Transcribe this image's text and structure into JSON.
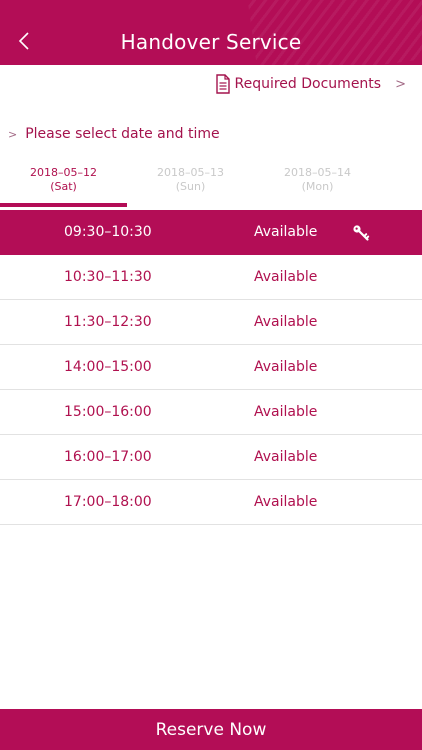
{
  "header": {
    "title": "Handover Service",
    "back_icon": "chevron-left-icon"
  },
  "required_docs": {
    "label": "Required Documents",
    "icon": "document-icon",
    "chevron": ">"
  },
  "prompt": {
    "arrow": ">",
    "text": "Please select date and time"
  },
  "tabs": [
    {
      "date": "2018–05–12",
      "day": "(Sat)",
      "active": true
    },
    {
      "date": "2018–05–13",
      "day": "(Sun)",
      "active": false
    },
    {
      "date": "2018–05–14",
      "day": "(Mon)",
      "active": false
    }
  ],
  "slots": [
    {
      "time": "09:30–10:30",
      "status": "Available",
      "selected": true
    },
    {
      "time": "10:30–11:30",
      "status": "Available",
      "selected": false
    },
    {
      "time": "11:30–12:30",
      "status": "Available",
      "selected": false
    },
    {
      "time": "14:00–15:00",
      "status": "Available",
      "selected": false
    },
    {
      "time": "15:00–16:00",
      "status": "Available",
      "selected": false
    },
    {
      "time": "16:00–17:00",
      "status": "Available",
      "selected": false
    },
    {
      "time": "17:00–18:00",
      "status": "Available",
      "selected": false
    }
  ],
  "reserve": {
    "label": "Reserve Now"
  },
  "colors": {
    "brand": "#b30d56",
    "text_accent": "#b0114f",
    "inactive": "#c9c9c9",
    "divider": "#e2e2e2"
  }
}
